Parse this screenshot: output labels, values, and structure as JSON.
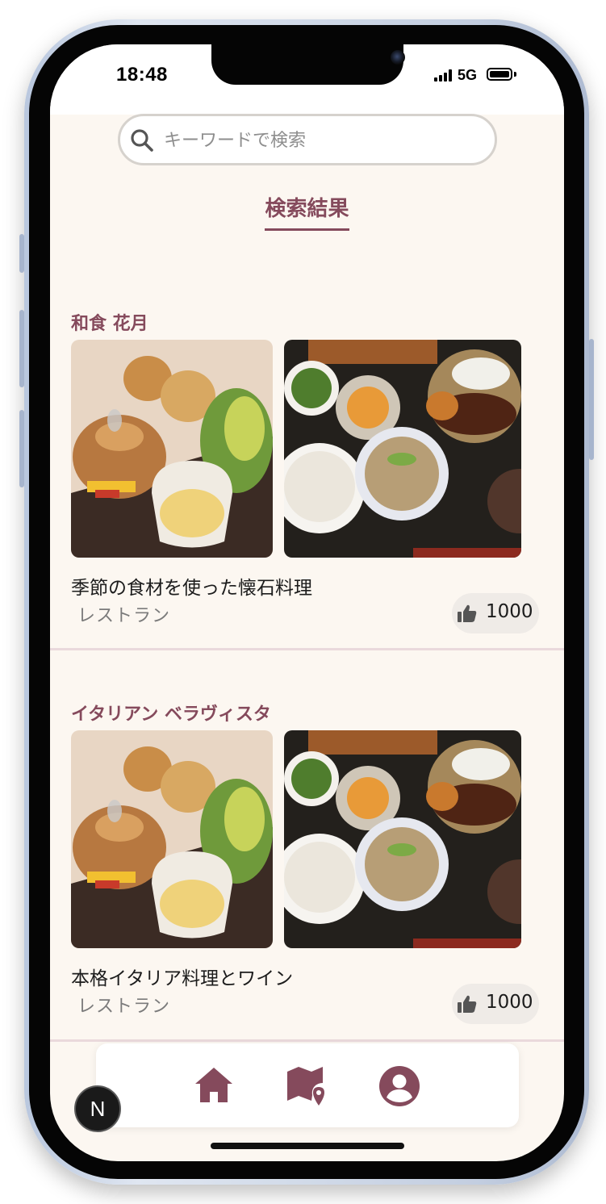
{
  "status_bar": {
    "time": "18:48",
    "network": "5G"
  },
  "search": {
    "placeholder": "キーワードで検索",
    "value": ""
  },
  "page_title": "検索結果",
  "results": [
    {
      "name": "和食 花月",
      "description": "季節の食材を使った懐石料理",
      "category": "レストラン",
      "likes": "1000"
    },
    {
      "name": "イタリアン ベラヴィスタ",
      "description": "本格イタリア料理とワイン",
      "category": "レストラン",
      "likes": "1000"
    }
  ],
  "bottom_nav": {
    "items": [
      "home-icon",
      "map-icon",
      "account-icon"
    ]
  },
  "dev_badge": "N",
  "colors": {
    "accent": "#854a5c",
    "background": "#fcf7f1",
    "like_chip": "#efebe7",
    "divider": "#ead9dc"
  }
}
